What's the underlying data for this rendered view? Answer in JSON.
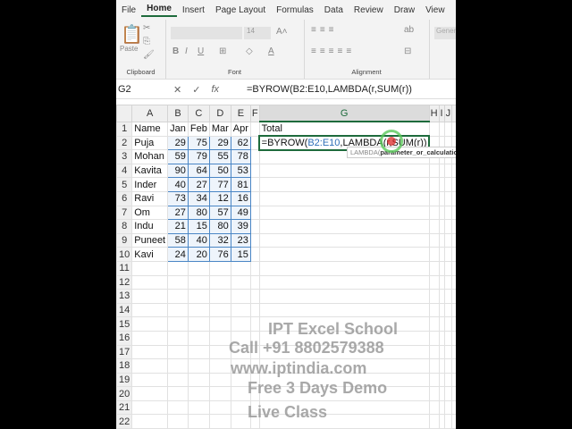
{
  "tabs": [
    "File",
    "Home",
    "Insert",
    "Page Layout",
    "Formulas",
    "Data",
    "Review",
    "Draw",
    "View",
    "R"
  ],
  "ribbon": {
    "clipboard": "Clipboard",
    "paste": "Paste",
    "font": "Font",
    "font_size": "14",
    "alignment": "Alignment",
    "number_format": "Genera"
  },
  "formula_bar": {
    "name_box": "G2",
    "cancel": "✕",
    "enter": "✓",
    "fx": "fx",
    "formula": "=BYROW(B2:E10,LAMBDA(r,SUM(r))"
  },
  "columns": [
    "A",
    "B",
    "C",
    "D",
    "E",
    "F",
    "G",
    "H",
    "I",
    "J",
    ""
  ],
  "header_row": [
    "Name",
    "Jan",
    "Feb",
    "Mar",
    "Apr"
  ],
  "total_label": "Total",
  "rows": [
    [
      "Puja",
      29,
      75,
      29,
      62
    ],
    [
      "Mohan",
      59,
      79,
      55,
      78
    ],
    [
      "Kavita",
      90,
      64,
      50,
      53
    ],
    [
      "Inder",
      40,
      27,
      77,
      81
    ],
    [
      "Ravi",
      73,
      34,
      12,
      16
    ],
    [
      "Om",
      27,
      80,
      57,
      49
    ],
    [
      "Indu",
      21,
      15,
      80,
      39
    ],
    [
      "Puneet",
      58,
      40,
      32,
      23
    ],
    [
      "Kavi",
      24,
      20,
      76,
      15
    ]
  ],
  "editing": {
    "prefix": "=BYROW(",
    "ref": "B2:E10",
    "suffix": ",LAMBDA(r,SUM(r))"
  },
  "tooltip": {
    "fn": "LAMBDA(",
    "arg": "parameter_or_calculation"
  },
  "watermark": [
    "IPT Excel School",
    "Call +91 8802579388",
    "www.iptindia.com",
    "Free 3 Days Demo",
    "Live Class"
  ]
}
